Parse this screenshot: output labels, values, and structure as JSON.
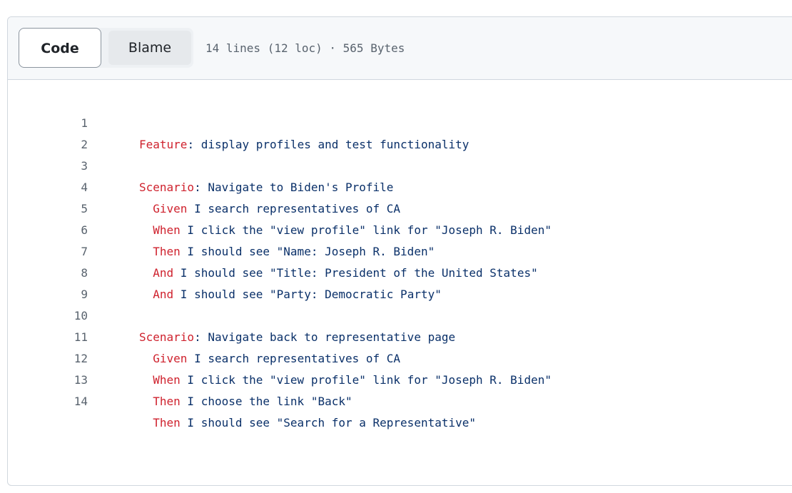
{
  "toolbar": {
    "code_tab": "Code",
    "blame_tab": "Blame",
    "file_info": "14 lines (12 loc) · 565 Bytes"
  },
  "lines": [
    {
      "num": "1",
      "indent": "",
      "keyword": "Feature",
      "text": ": display profiles and test functionality"
    },
    {
      "num": "2",
      "indent": "",
      "keyword": "",
      "text": ""
    },
    {
      "num": "3",
      "indent": "",
      "keyword": "Scenario",
      "text": ": Navigate to Biden's Profile"
    },
    {
      "num": "4",
      "indent": "  ",
      "keyword": "Given",
      "text": " I search representatives of CA"
    },
    {
      "num": "5",
      "indent": "  ",
      "keyword": "When",
      "text": " I click the \"view profile\" link for \"Joseph R. Biden\""
    },
    {
      "num": "6",
      "indent": "  ",
      "keyword": "Then",
      "text": " I should see \"Name: Joseph R. Biden\""
    },
    {
      "num": "7",
      "indent": "  ",
      "keyword": "And",
      "text": " I should see \"Title: President of the United States\""
    },
    {
      "num": "8",
      "indent": "  ",
      "keyword": "And",
      "text": " I should see \"Party: Democratic Party\""
    },
    {
      "num": "9",
      "indent": "",
      "keyword": "",
      "text": ""
    },
    {
      "num": "10",
      "indent": "",
      "keyword": "Scenario",
      "text": ": Navigate back to representative page"
    },
    {
      "num": "11",
      "indent": "  ",
      "keyword": "Given",
      "text": " I search representatives of CA"
    },
    {
      "num": "12",
      "indent": "  ",
      "keyword": "When",
      "text": " I click the \"view profile\" link for \"Joseph R. Biden\""
    },
    {
      "num": "13",
      "indent": "  ",
      "keyword": "Then",
      "text": " I choose the link \"Back\""
    },
    {
      "num": "14",
      "indent": "  ",
      "keyword": "Then",
      "text": " I should see \"Search for a Representative\""
    }
  ],
  "colors": {
    "keyword": "#cf222e",
    "text": "#0a3069",
    "line_number": "#59636e"
  }
}
